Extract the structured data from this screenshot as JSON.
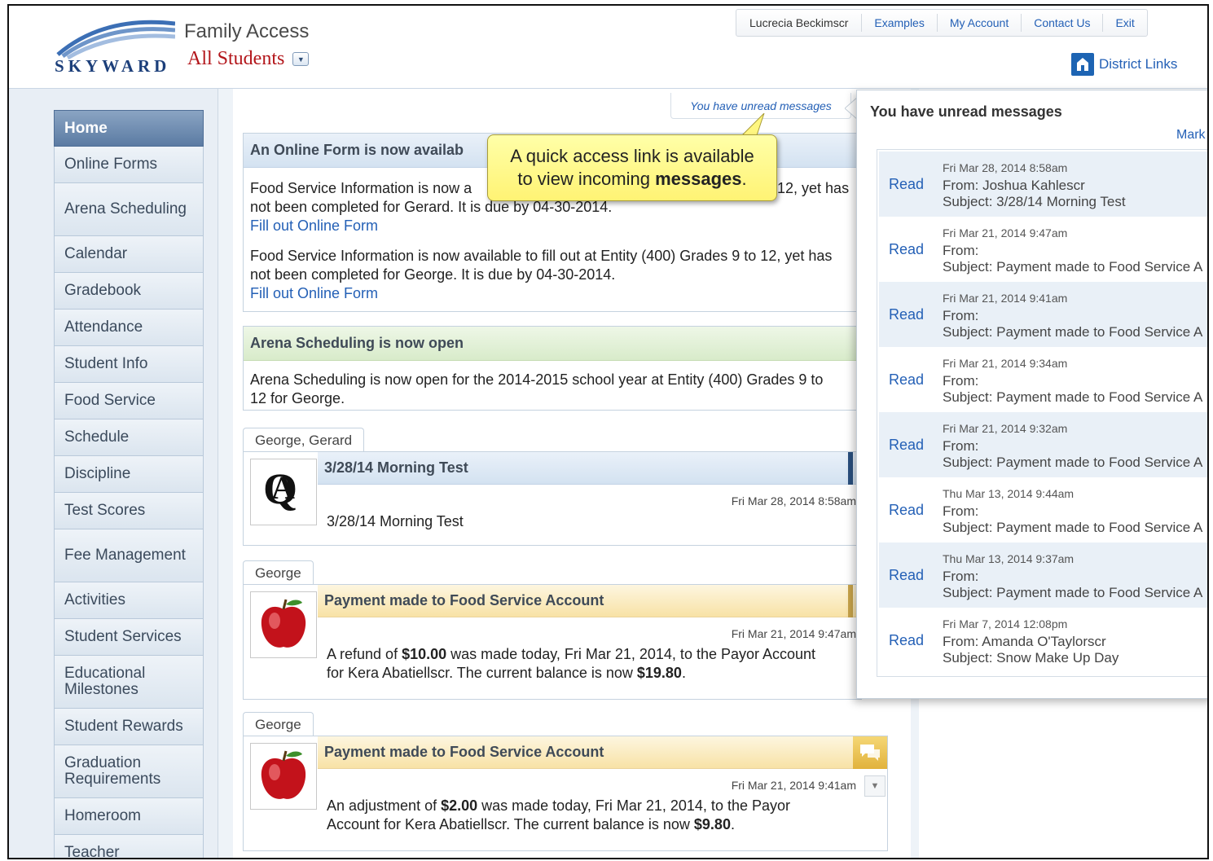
{
  "header": {
    "logo_text": "SKYWARD",
    "app_title": "Family Access",
    "student_selector": "All Students",
    "topnav": {
      "user": "Lucrecia Beckimscr",
      "examples": "Examples",
      "my_account": "My Account",
      "contact_us": "Contact Us",
      "exit": "Exit"
    },
    "district_links": "District Links"
  },
  "sidebar": {
    "items": [
      {
        "label": "Home"
      },
      {
        "label": "Online Forms"
      },
      {
        "label": "Arena Scheduling"
      },
      {
        "label": "Calendar"
      },
      {
        "label": "Gradebook"
      },
      {
        "label": "Attendance"
      },
      {
        "label": "Student Info"
      },
      {
        "label": "Food Service"
      },
      {
        "label": "Schedule"
      },
      {
        "label": "Discipline"
      },
      {
        "label": "Test Scores"
      },
      {
        "label": "Fee Management"
      },
      {
        "label": "Activities"
      },
      {
        "label": "Student Services"
      },
      {
        "label": "Educational Milestones"
      },
      {
        "label": "Student Rewards"
      },
      {
        "label": "Graduation Requirements"
      },
      {
        "label": "Homeroom"
      },
      {
        "label": "Teacher"
      }
    ]
  },
  "unread_link": "You have unread messages",
  "callout": {
    "line1": "A quick access link is available",
    "line2_prefix": "to view incoming ",
    "line2_bold": "messages",
    "line2_suffix": "."
  },
  "online_form": {
    "title": "An Online Form is now availab",
    "p1_line1": "Food Service Information is now a",
    "p1_line1_end": "o 12, yet has",
    "p1_line2": "not been completed for Gerard.  It is due by 04-30-2014.",
    "link1": "Fill out Online Form",
    "p2_line1": "Food Service Information is now available to fill out at Entity (400) Grades 9 to 12, yet has",
    "p2_line2": "not been completed for George.  It is due by 04-30-2014.",
    "link2": "Fill out Online Form"
  },
  "arena": {
    "title": "Arena Scheduling is now open",
    "line1": "Arena Scheduling is now open for the 2014-2015 school year at Entity (400) Grades 9 to",
    "line2": "12 for George."
  },
  "messages": [
    {
      "tab": "George, Gerard",
      "title": "3/28/14 Morning Test",
      "date": "Fri Mar 28, 2014 8:58am",
      "body_line1": "3/28/14 Morning Test"
    },
    {
      "tab": "George",
      "title": "Payment made to Food Service Account",
      "date": "Fri Mar 21, 2014 9:47am",
      "b1_pre": "A refund of ",
      "b1_bold": "$10.00",
      "b1_post": " was made today, Fri Mar 21, 2014, to the Payor Account",
      "b2_pre": "for Kera Abatiellscr. The current balance is now ",
      "b2_bold": "$19.80",
      "b2_post": "."
    },
    {
      "tab": "George",
      "title": "Payment made to Food Service Account",
      "date": "Fri Mar 21, 2014 9:41am",
      "b1_pre": "An adjustment of ",
      "b1_bold": "$2.00",
      "b1_post": " was made today, Fri Mar 21, 2014, to the Payor",
      "b2_pre": "Account for Kera Abatiellscr. The current balance is now ",
      "b2_bold": "$9.80",
      "b2_post": "."
    }
  ],
  "popup": {
    "title": "You have unread messages",
    "mark": "Mark",
    "read_label": "Read",
    "items": [
      {
        "date": "Fri Mar 28, 2014 8:58am",
        "from": "From: Joshua Kahlescr",
        "subject": "Subject: 3/28/14 Morning Test"
      },
      {
        "date": "Fri Mar 21, 2014 9:47am",
        "from": "From:",
        "subject": "Subject: Payment made to Food Service A"
      },
      {
        "date": "Fri Mar 21, 2014 9:41am",
        "from": "From:",
        "subject": "Subject: Payment made to Food Service A"
      },
      {
        "date": "Fri Mar 21, 2014 9:34am",
        "from": "From:",
        "subject": "Subject: Payment made to Food Service A"
      },
      {
        "date": "Fri Mar 21, 2014 9:32am",
        "from": "From:",
        "subject": "Subject: Payment made to Food Service A"
      },
      {
        "date": "Thu Mar 13, 2014 9:44am",
        "from": "From:",
        "subject": "Subject: Payment made to Food Service A"
      },
      {
        "date": "Thu Mar 13, 2014 9:37am",
        "from": "From:",
        "subject": "Subject: Payment made to Food Service A"
      },
      {
        "date": "Fri Mar 7, 2014 12:08pm",
        "from": "From: Amanda O'Taylorscr",
        "subject": "Subject: Snow Make Up Day"
      }
    ]
  },
  "colors": {
    "accent_blue": "#2460b6",
    "brand_red": "#b3161b",
    "callout_yellow": "#fff374"
  }
}
